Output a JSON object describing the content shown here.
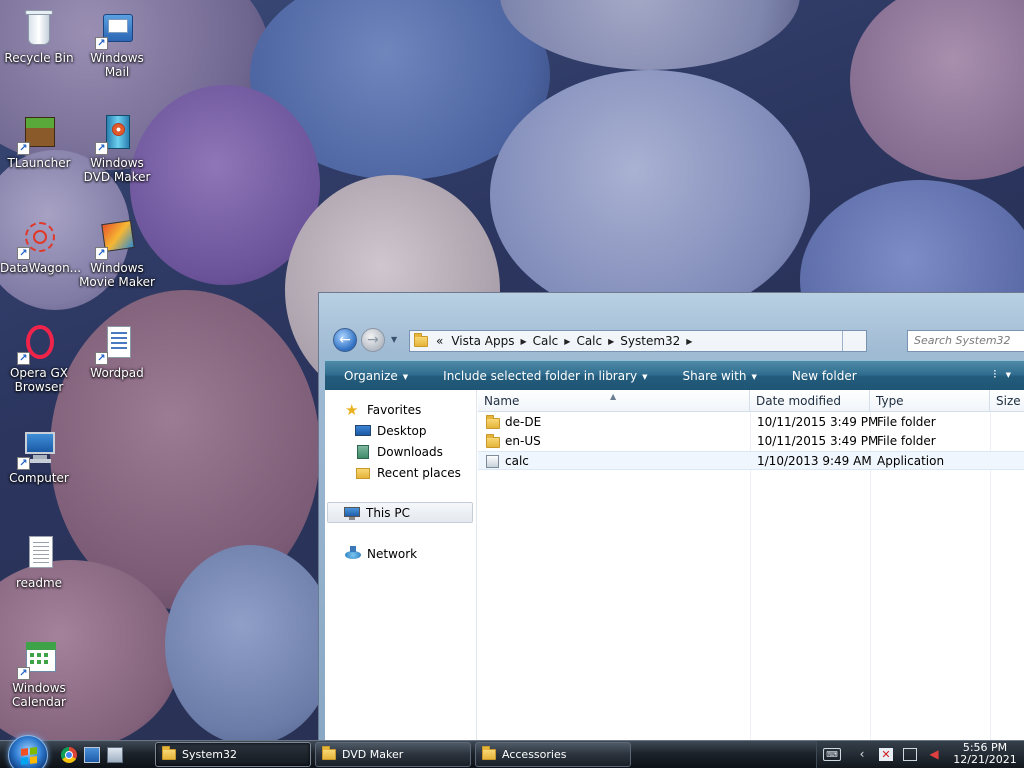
{
  "desktop": {
    "icons": [
      {
        "id": "recycle-bin",
        "label": "Recycle Bin",
        "icon": "recycle-bin-icon",
        "shortcut": false
      },
      {
        "id": "windows-mail",
        "label": "Windows Mail",
        "icon": "mail-icon",
        "shortcut": true
      },
      {
        "id": "tlauncher",
        "label": "TLauncher",
        "icon": "grass-block-icon",
        "shortcut": true
      },
      {
        "id": "windows-dvd-maker",
        "label": "Windows DVD Maker",
        "icon": "dvd-icon",
        "shortcut": true
      },
      {
        "id": "datawagon",
        "label": "DataWagon...",
        "icon": "datawagon-icon",
        "shortcut": true
      },
      {
        "id": "windows-movie-maker",
        "label": "Windows Movie Maker",
        "icon": "film-icon",
        "shortcut": true
      },
      {
        "id": "opera-gx",
        "label": "Opera GX Browser",
        "icon": "opera-icon",
        "shortcut": true
      },
      {
        "id": "wordpad",
        "label": "Wordpad",
        "icon": "wordpad-icon",
        "shortcut": true
      },
      {
        "id": "computer",
        "label": "Computer",
        "icon": "computer-icon",
        "shortcut": true
      },
      {
        "id": "readme",
        "label": "readme",
        "icon": "document-icon",
        "shortcut": false
      },
      {
        "id": "windows-calendar",
        "label": "Windows Calendar",
        "icon": "calendar-icon",
        "shortcut": true
      }
    ]
  },
  "explorer": {
    "address": {
      "overflow_glyph": "«",
      "crumbs": [
        "Vista Apps",
        "Calc",
        "Calc",
        "System32"
      ]
    },
    "search_placeholder": "Search System32",
    "toolbar": {
      "organize": "Organize",
      "include_in_library": "Include selected folder in library",
      "share_with": "Share with",
      "new_folder": "New folder"
    },
    "nav_pane": {
      "favorites": "Favorites",
      "desktop": "Desktop",
      "downloads": "Downloads",
      "recent_places": "Recent places",
      "this_pc": "This PC",
      "network": "Network"
    },
    "columns": {
      "name": "Name",
      "date_modified": "Date modified",
      "type": "Type",
      "size": "Size"
    },
    "files": [
      {
        "name": "de-DE",
        "date_modified": "10/11/2015 3:49 PM",
        "type": "File folder",
        "kind": "folder",
        "selected": false
      },
      {
        "name": "en-US",
        "date_modified": "10/11/2015 3:49 PM",
        "type": "File folder",
        "kind": "folder",
        "selected": false
      },
      {
        "name": "calc",
        "date_modified": "1/10/2013 9:49 AM",
        "type": "Application",
        "kind": "application",
        "selected": true
      }
    ]
  },
  "taskbar": {
    "quick_launch": [
      "chrome-icon",
      "show-desktop-icon",
      "switch-windows-icon"
    ],
    "buttons": [
      {
        "label": "System32",
        "active": true
      },
      {
        "label": "DVD Maker",
        "active": false
      },
      {
        "label": "Accessories",
        "active": false
      }
    ],
    "tray": {
      "icons": [
        "keyboard-icon",
        "show-hidden-icon",
        "action-center-icon",
        "network-icon",
        "volume-muted-icon"
      ],
      "time": "5:56 PM",
      "date": "12/21/2021"
    }
  }
}
